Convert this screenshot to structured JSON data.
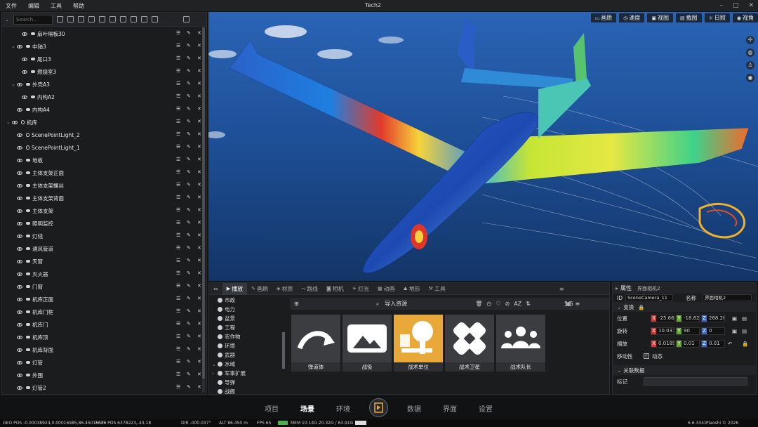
{
  "menu": {
    "file": "文件",
    "edit": "编辑",
    "tools": "工具",
    "help": "帮助",
    "title": "Tech2"
  },
  "search": {
    "placeholder": "Search.."
  },
  "tree": [
    {
      "label": "扇叶隔板30",
      "depth": 2,
      "kind": "mesh",
      "chev": ""
    },
    {
      "label": "中轴3",
      "depth": 1,
      "kind": "mesh",
      "chev": "⌄"
    },
    {
      "label": "尾口3",
      "depth": 2,
      "kind": "mesh",
      "chev": ""
    },
    {
      "label": "燃烧室3",
      "depth": 2,
      "kind": "mesh",
      "chev": ""
    },
    {
      "label": "外壳A3",
      "depth": 1,
      "kind": "mesh",
      "chev": "⌄"
    },
    {
      "label": "内构A2",
      "depth": 2,
      "kind": "mesh",
      "chev": ""
    },
    {
      "label": "内构A4",
      "depth": 1,
      "kind": "mesh",
      "chev": ""
    },
    {
      "label": "机库",
      "depth": 0,
      "kind": "light",
      "chev": "⌄"
    },
    {
      "label": "ScenePointLight_2",
      "depth": 1,
      "kind": "light",
      "chev": ""
    },
    {
      "label": "ScenePointLight_1",
      "depth": 1,
      "kind": "light",
      "chev": ""
    },
    {
      "label": "地板",
      "depth": 1,
      "kind": "mesh",
      "chev": ""
    },
    {
      "label": "主体支架正面",
      "depth": 1,
      "kind": "mesh",
      "chev": ""
    },
    {
      "label": "主体支架螺丝",
      "depth": 1,
      "kind": "mesh",
      "chev": ""
    },
    {
      "label": "主体支架背面",
      "depth": 1,
      "kind": "mesh",
      "chev": ""
    },
    {
      "label": "主体支架",
      "depth": 1,
      "kind": "mesh",
      "chev": ""
    },
    {
      "label": "照明监控",
      "depth": 1,
      "kind": "mesh",
      "chev": ""
    },
    {
      "label": "灯线",
      "depth": 1,
      "kind": "mesh",
      "chev": ""
    },
    {
      "label": "通风管道",
      "depth": 1,
      "kind": "mesh",
      "chev": ""
    },
    {
      "label": "天窗",
      "depth": 1,
      "kind": "mesh",
      "chev": ""
    },
    {
      "label": "灭火器",
      "depth": 1,
      "kind": "mesh",
      "chev": ""
    },
    {
      "label": "门窗",
      "depth": 1,
      "kind": "mesh",
      "chev": ""
    },
    {
      "label": "机库正面",
      "depth": 1,
      "kind": "mesh",
      "chev": ""
    },
    {
      "label": "机库门框",
      "depth": 1,
      "kind": "mesh",
      "chev": ""
    },
    {
      "label": "机库门",
      "depth": 1,
      "kind": "mesh",
      "chev": ""
    },
    {
      "label": "机库顶",
      "depth": 1,
      "kind": "mesh",
      "chev": ""
    },
    {
      "label": "机库背面",
      "depth": 1,
      "kind": "mesh",
      "chev": ""
    },
    {
      "label": "灯管",
      "depth": 1,
      "kind": "mesh",
      "chev": ""
    },
    {
      "label": "外围",
      "depth": 1,
      "kind": "mesh",
      "chev": ""
    },
    {
      "label": "灯管2",
      "depth": 1,
      "kind": "mesh",
      "chev": ""
    }
  ],
  "viewport": {
    "buttons": [
      "画质",
      "速度",
      "视图",
      "截图",
      "日照",
      "视角"
    ]
  },
  "tabs": [
    "播放",
    "画刷",
    "材质",
    "路线",
    "相机",
    "灯光",
    "动画",
    "地形",
    "工具"
  ],
  "categories": [
    "市政",
    "电力",
    "盆景",
    "工程",
    "农作物",
    "环境",
    "武器",
    "水域",
    "军事扩展",
    "导弹",
    "战舰"
  ],
  "assets": {
    "import": "导入资源",
    "count": "5/5",
    "items": [
      "弹道体",
      "战役",
      "战术单位",
      "战术卫星",
      "战术队长"
    ]
  },
  "props": {
    "title": "属性",
    "camera": "界面相机2",
    "id_label": "ID",
    "id_value": "SceneCamera_11",
    "name_label": "名称",
    "name_value": "界面相机2",
    "transform": "变换",
    "pos_label": "位置",
    "pos": [
      "-25.6626",
      "-18.8258",
      "268.2685"
    ],
    "rot_label": "旋转",
    "rot": [
      "10.0371",
      "90",
      "0"
    ],
    "scale_label": "缩放",
    "scale": [
      "0.01893",
      "0.01",
      "0.01"
    ],
    "move_label": "移动性",
    "move_value": "动态",
    "related": "关联数据",
    "mark_label": "标记"
  },
  "nav": [
    "项目",
    "场景",
    "环境",
    "数据",
    "界面",
    "设置"
  ],
  "status": {
    "geo": "GEO POS  -0.00038924,0.00016985,86.45015525",
    "ecef": "ECEF POS  6378223,-43,18",
    "dir": "DIR  -000.037°",
    "alt": "ALT  86.450 m",
    "fps": "FPS  65",
    "mem": "MEM  10.14G  20.32G / 63.91G",
    "ver": "6.6.3341",
    "copy": "Piaoshi © 2026"
  },
  "colors": {
    "accent": "#e9a93a",
    "panel": "#1b1c1e"
  }
}
